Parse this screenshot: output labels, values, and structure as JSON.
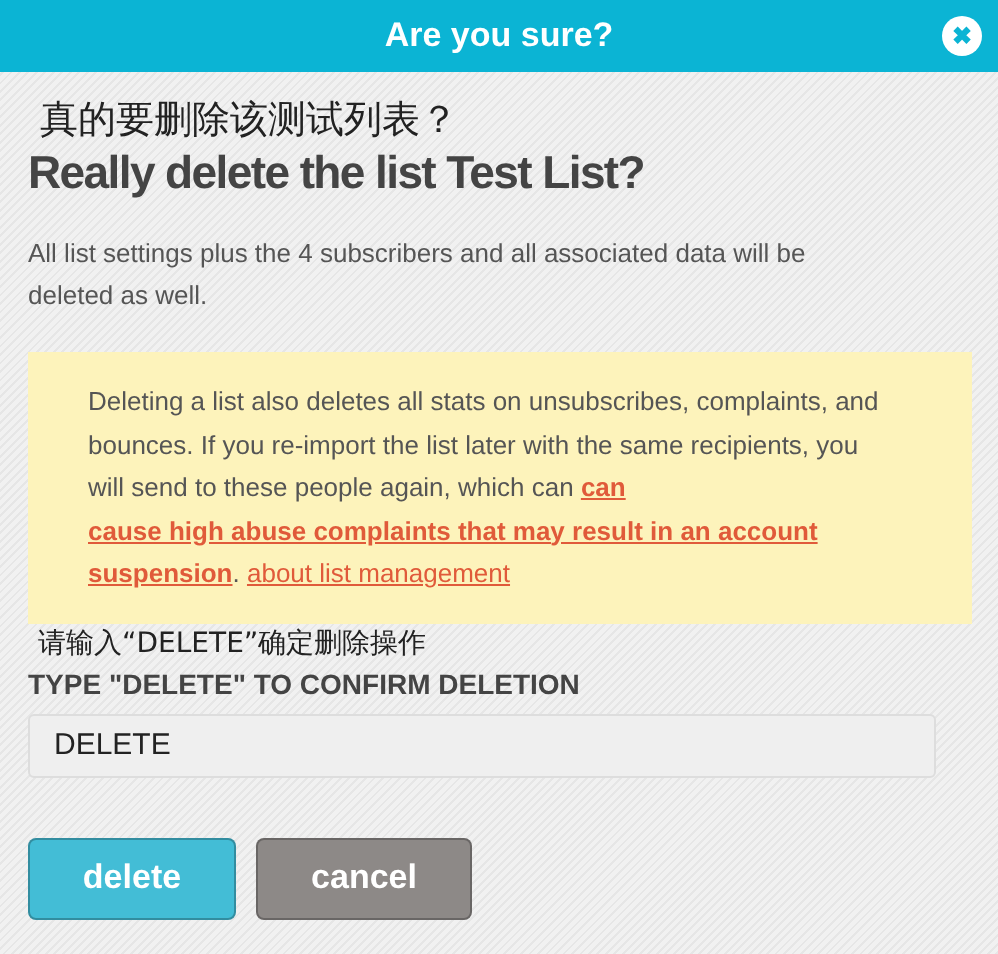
{
  "dialog": {
    "title": "Are you sure?",
    "close_icon": "✖"
  },
  "heading_zh": "真的要删除该测试列表？",
  "heading": "Really delete the list Test List?",
  "description": "All list settings plus the 4 subscribers and all associated data will be deleted as well.",
  "warning": {
    "text": "Deleting a list also deletes all stats on unsubscribes, complaints, and bounces. If you re-import the list later with the same recipients, you will send to these people again, which can ",
    "warning_link_lines": [
      "can",
      "cause high abuse complaints that may result in an account",
      "suspension"
    ],
    "separator": ".",
    "help_link": "about list management"
  },
  "confirm_label_zh": "请输入“DELETE”确定删除操作",
  "confirm_label": "TYPE \"DELETE\" TO CONFIRM DELETION",
  "confirm_field": {
    "value": "DELETE"
  },
  "buttons": [
    {
      "label": "delete",
      "kind": "primary"
    },
    {
      "label": "cancel",
      "kind": "secondary"
    }
  ]
}
